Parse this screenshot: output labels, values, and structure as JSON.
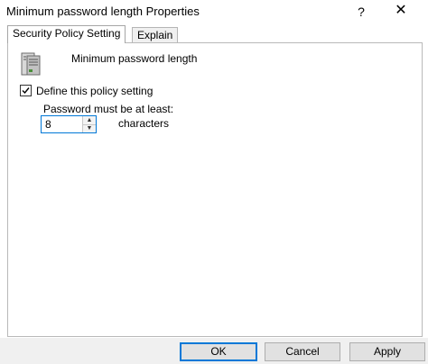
{
  "window": {
    "title": "Minimum password length Properties",
    "help_glyph": "?",
    "close_glyph": "✕"
  },
  "tabs": [
    {
      "label": "Security Policy Setting",
      "active": true
    },
    {
      "label": "Explain",
      "active": false
    }
  ],
  "policy": {
    "name": "Minimum password length",
    "icon": "server-policy-icon"
  },
  "define": {
    "label": "Define this policy setting",
    "checked": true
  },
  "password": {
    "label": "Password must be at least:",
    "value": "8",
    "unit": "characters"
  },
  "buttons": {
    "ok": "OK",
    "cancel": "Cancel",
    "apply": "Apply"
  },
  "colors": {
    "accent": "#0078d7",
    "button_bg": "#e1e1e1",
    "footer_bg": "#f0f0f0"
  }
}
